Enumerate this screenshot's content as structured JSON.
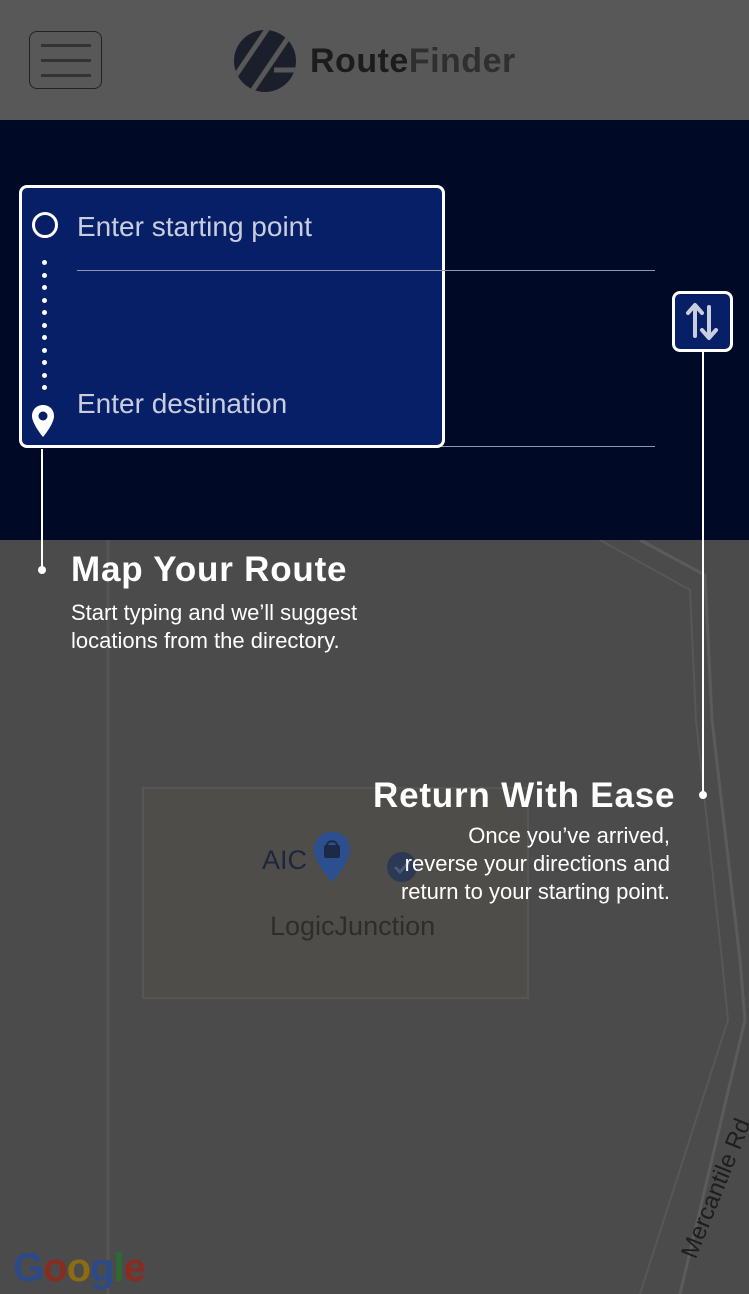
{
  "header": {
    "brand_route": "Route",
    "brand_finder": "Finder"
  },
  "search": {
    "start_placeholder": "Enter starting point",
    "destination_placeholder": "Enter destination"
  },
  "callouts": {
    "route": {
      "title": "Map Your Route",
      "body_line1": "Start typing and we’ll suggest",
      "body_line2": "locations from the directory."
    },
    "return": {
      "title": "Return With Ease",
      "body_line1": "Once you’ve arrived,",
      "body_line2": "reverse your directions and",
      "body_line3": "return to your starting point."
    }
  },
  "map": {
    "poi_label_1": "AIC",
    "poi_label_2": "LogicJunction",
    "road_label": "Mercantile Rd",
    "attribution": "Google"
  },
  "icons": {
    "menu": "hamburger-icon",
    "logo": "routefinder-logo-icon",
    "origin": "origin-circle-icon",
    "destination": "map-pin-icon",
    "swap": "swap-arrows-icon",
    "poi": "shopping-bag-pin-icon"
  },
  "colors": {
    "panel_bg": "#000a26",
    "highlight_bg": "#071f66",
    "map_overlay": "#4b4b4b",
    "text_white": "#ffffff"
  }
}
